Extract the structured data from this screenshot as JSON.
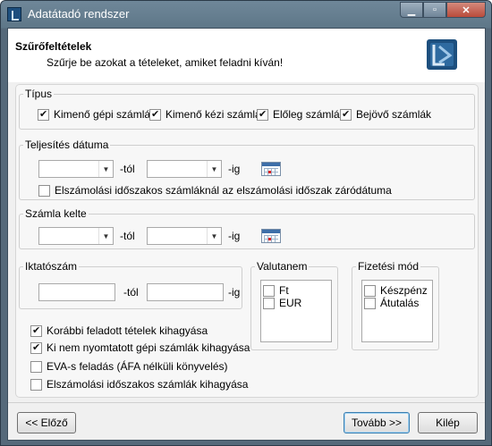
{
  "window": {
    "title": "Adatátadó rendszer"
  },
  "header": {
    "title": "Szűrőfeltételek",
    "subtitle": "Szűrje be azokat a tételeket, amiket feladni kíván!"
  },
  "tipus": {
    "label": "Típus",
    "items": [
      {
        "label": "Kimenő gépi számlák",
        "checked": true
      },
      {
        "label": "Kimenő kézi számlák",
        "checked": true
      },
      {
        "label": "Előleg számlák",
        "checked": true
      },
      {
        "label": "Bejövő számlák",
        "checked": true
      }
    ]
  },
  "teljesites": {
    "label": "Teljesítés dátuma",
    "from_value": "",
    "from_suffix": "-tól",
    "to_value": "",
    "to_suffix": "-ig",
    "period_checkbox": {
      "label": "Elszámolási időszakos számláknál az elszámolási időszak záródátuma",
      "checked": false
    }
  },
  "szamla_kelte": {
    "label": "Számla kelte",
    "from_value": "",
    "from_suffix": "-tól",
    "to_value": "",
    "to_suffix": "-ig"
  },
  "iktatoszam": {
    "label": "Iktatószám",
    "from_value": "",
    "from_suffix": "-tól",
    "to_value": "",
    "to_suffix": "-ig"
  },
  "valutanem": {
    "label": "Valutanem",
    "items": [
      {
        "label": "Ft",
        "checked": false
      },
      {
        "label": "EUR",
        "checked": false
      }
    ]
  },
  "fizetesi_mod": {
    "label": "Fizetési mód",
    "items": [
      {
        "label": "Készpénz",
        "checked": false
      },
      {
        "label": "Átutalás",
        "checked": false
      }
    ]
  },
  "options": [
    {
      "label": "Korábbi feladott tételek kihagyása",
      "checked": true
    },
    {
      "label": "Ki nem nyomtatott gépi számlák kihagyása",
      "checked": true
    },
    {
      "label": "EVA-s feladás (ÁFA nélküli könyvelés)",
      "checked": false
    },
    {
      "label": "Elszámolási időszakos számlák kihagyása",
      "checked": false
    }
  ],
  "buttons": {
    "back": "<< Előző",
    "next": "Tovább >>",
    "exit": "Kilép"
  },
  "icons": {
    "app": "app-logo-icon",
    "calendar": "calendar-icon",
    "dropdown": "chevron-down-icon"
  },
  "colors": {
    "titlebar": "#5e7788",
    "client_bg": "#f0f0f0",
    "panel_bg": "#f7f7f7",
    "logo_blue": "#1d4f7e"
  }
}
